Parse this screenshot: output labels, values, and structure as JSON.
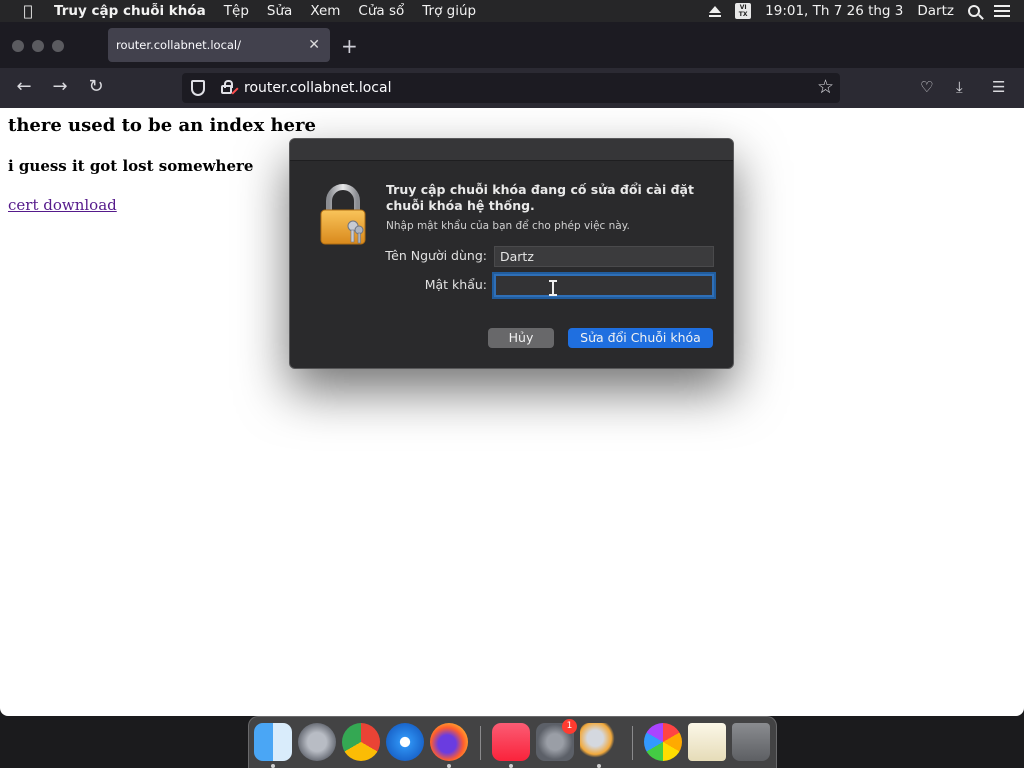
{
  "menubar": {
    "app_name": "Truy cập chuỗi khóa",
    "menus": [
      "Tệp",
      "Sửa",
      "Xem",
      "Cửa sổ",
      "Trợ giúp"
    ],
    "input_source": "VI TX",
    "clock": "19:01, Th 7 26 thg 3",
    "user": "Dartz"
  },
  "browser": {
    "tab_title": "router.collabnet.local/",
    "url_host": "router.collabnet.local"
  },
  "page": {
    "heading": "there used to be an index here",
    "subheading": "i guess it got lost somewhere",
    "link": "cert download"
  },
  "dialog": {
    "title": "Truy cập chuỗi khóa đang cố sửa đổi cài đặt chuỗi khóa hệ thống.",
    "message": "Nhập mật khẩu của bạn để cho phép việc này.",
    "username_label": "Tên Người dùng:",
    "username_value": "Dartz",
    "password_label": "Mật khẩu:",
    "password_value": "",
    "cancel_label": "Hủy",
    "confirm_label": "Sửa đổi Chuỗi khóa"
  },
  "dock": {
    "apps": [
      "finder",
      "launchpad",
      "chrome",
      "safari",
      "firefox",
      "music",
      "system-preferences",
      "keychain-access",
      "photos",
      "certificate",
      "trash"
    ],
    "system_preferences_badge": "1"
  },
  "colors": {
    "accent": "#1f6fe0",
    "link_visited": "#551a8b",
    "badge": "#ff3b30"
  }
}
